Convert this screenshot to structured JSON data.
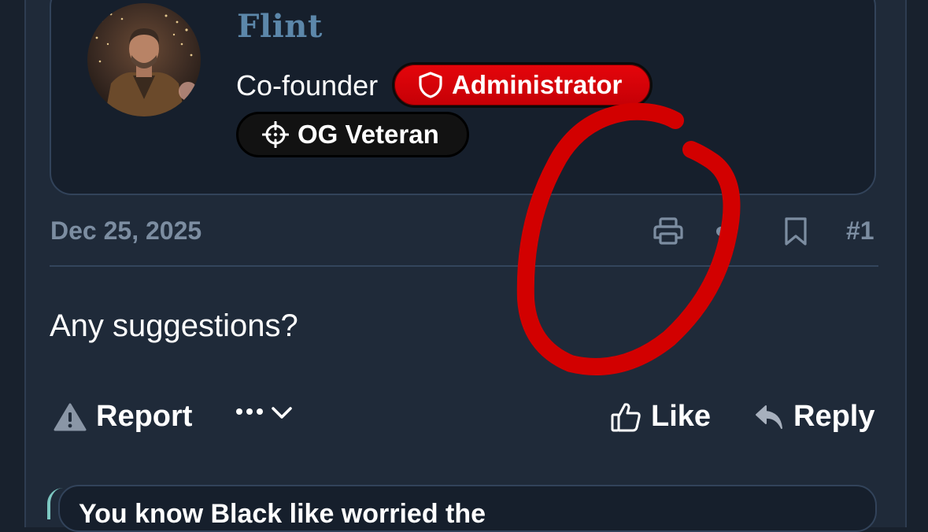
{
  "post": {
    "author": {
      "username": "Flint",
      "user_title": "Co-founder",
      "badges": [
        {
          "label": "Administrator",
          "icon": "shield-icon",
          "color": "#e0060c"
        },
        {
          "label": "OG Veteran",
          "icon": "crosshair-icon",
          "color": "#121212"
        }
      ]
    },
    "date": "Dec 25, 2025",
    "meta_icons": [
      "printer-icon",
      "dot-icon",
      "bookmark-icon"
    ],
    "post_number": "#1",
    "message": "Any suggestions?",
    "actions": {
      "report_label": "Report",
      "more_label": "•••",
      "like_label": "Like",
      "reply_label": "Reply"
    }
  },
  "next_post": {
    "preview_text": "You know Black like worried the"
  },
  "colors": {
    "background": "#1f2a39",
    "card": "#161f2c",
    "username": "#5c87aa",
    "muted": "#7c8da1",
    "admin_badge": "#e0060c",
    "annotation": "#d20000"
  }
}
